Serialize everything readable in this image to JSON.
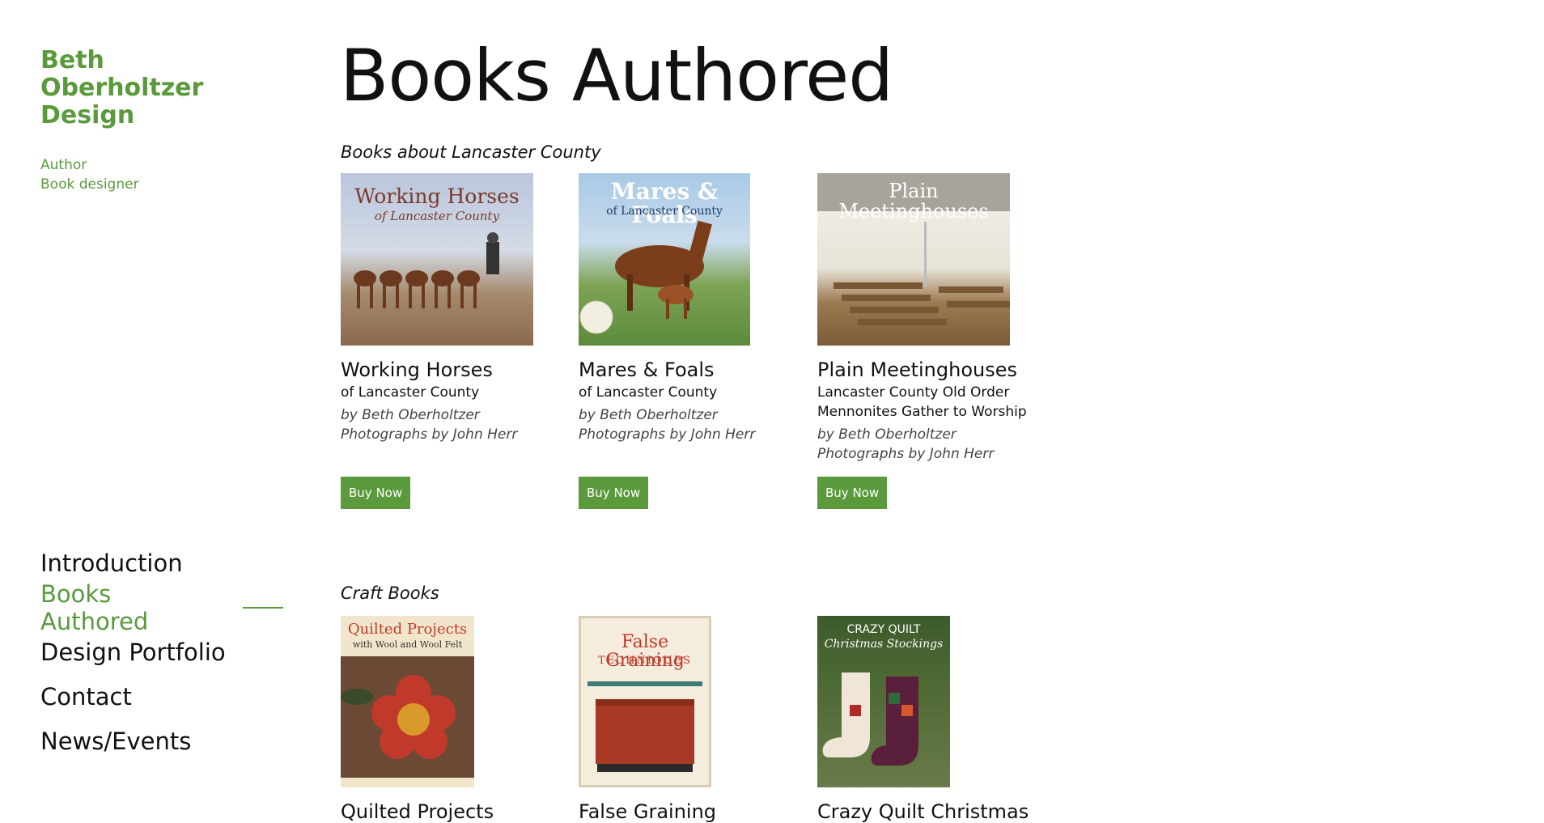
{
  "site": {
    "title_lines": [
      "Beth",
      "Oberholtzer",
      "Design"
    ],
    "tagline_lines": [
      "Author",
      "Book designer"
    ]
  },
  "nav": {
    "items": [
      {
        "label": "Introduction"
      },
      {
        "label": "Books Authored"
      },
      {
        "label": "Design Portfolio"
      },
      {
        "label": "Contact"
      },
      {
        "label": "News/Events"
      }
    ]
  },
  "page": {
    "title": "Books Authored"
  },
  "sections": [
    {
      "heading": "Books about Lancaster County",
      "books": [
        {
          "cover_text": "Working Horses",
          "cover_subtext": "of Lancaster County",
          "title": "Working Horses",
          "subtitle_lines": [
            "of Lancaster County"
          ],
          "author": "by Beth Oberholtzer",
          "photographer": "Photographs by John Herr",
          "buy_label": "Buy Now"
        },
        {
          "cover_text": "Mares & Foals",
          "cover_subtext": "of Lancaster County",
          "title": "Mares & Foals",
          "subtitle_lines": [
            "of Lancaster County"
          ],
          "author": "by Beth Oberholtzer",
          "photographer": "Photographs by John Herr",
          "buy_label": "Buy Now"
        },
        {
          "cover_text": "Plain Meetinghouses",
          "cover_subtext": "",
          "title": "Plain Meetinghouses",
          "subtitle_lines": [
            "Lancaster County Old Order",
            "Mennonites Gather to Worship"
          ],
          "author": "by Beth Oberholtzer",
          "photographer": "Photographs by John Herr",
          "buy_label": "Buy Now"
        }
      ]
    },
    {
      "heading": "Craft Books",
      "books": [
        {
          "cover_text": "Quilted Projects",
          "cover_subtext": "with Wool and Wool Felt",
          "title": "Quilted Projects"
        },
        {
          "cover_text": "False Graining",
          "cover_subtext": "TECHNIQUES",
          "title": "False Graining"
        },
        {
          "cover_text": "CRAZY QUILT",
          "cover_subtext": "Christmas Stockings",
          "title": "Crazy Quilt Christmas"
        }
      ]
    }
  ],
  "colors": {
    "accent": "#5a9a3c",
    "text": "#111111",
    "background": "#ffffff"
  }
}
